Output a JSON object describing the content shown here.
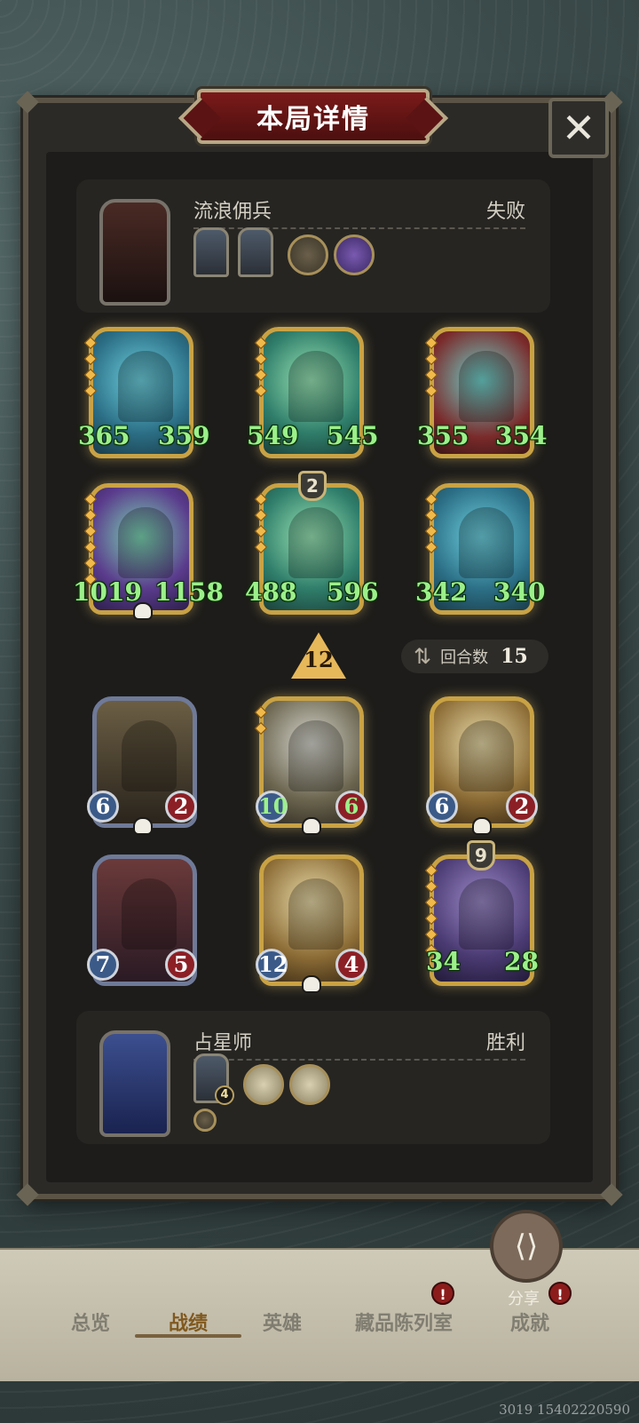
{
  "modal": {
    "title": "本局详情",
    "close_label": "✕"
  },
  "opponent": {
    "name": "流浪佣兵",
    "result": "失败",
    "units": [
      {
        "attack": "365",
        "health": "359"
      },
      {
        "attack": "549",
        "health": "545"
      },
      {
        "attack": "355",
        "health": "354"
      },
      {
        "attack": "1019",
        "health": "1158"
      },
      {
        "attack": "488",
        "health": "596",
        "tier": "2"
      },
      {
        "attack": "342",
        "health": "340"
      }
    ]
  },
  "level_indicator": "12",
  "round": {
    "label": "回合数",
    "value": "15",
    "icon": "swap-arrows-icon"
  },
  "player": {
    "name": "占星师",
    "result": "胜利",
    "card_badge": "4",
    "units": [
      {
        "attack": "6",
        "health": "2"
      },
      {
        "attack": "10",
        "health": "6"
      },
      {
        "attack": "6",
        "health": "2"
      },
      {
        "attack": "7",
        "health": "5"
      },
      {
        "attack": "12",
        "health": "4"
      },
      {
        "attack": "34",
        "health": "28",
        "tier": "9"
      }
    ]
  },
  "share": {
    "label": "分享",
    "icon": "share-icon"
  },
  "nav": {
    "items": [
      "总览",
      "战绩",
      "英雄",
      "藏品陈列室",
      "成就"
    ],
    "active": "战绩",
    "badge": "!"
  },
  "footer_code": "3019 15402220590",
  "colors": {
    "gold_border": "#c9a244",
    "stat_green": "#9cf08a",
    "banner_red": "#7b1a1a"
  }
}
